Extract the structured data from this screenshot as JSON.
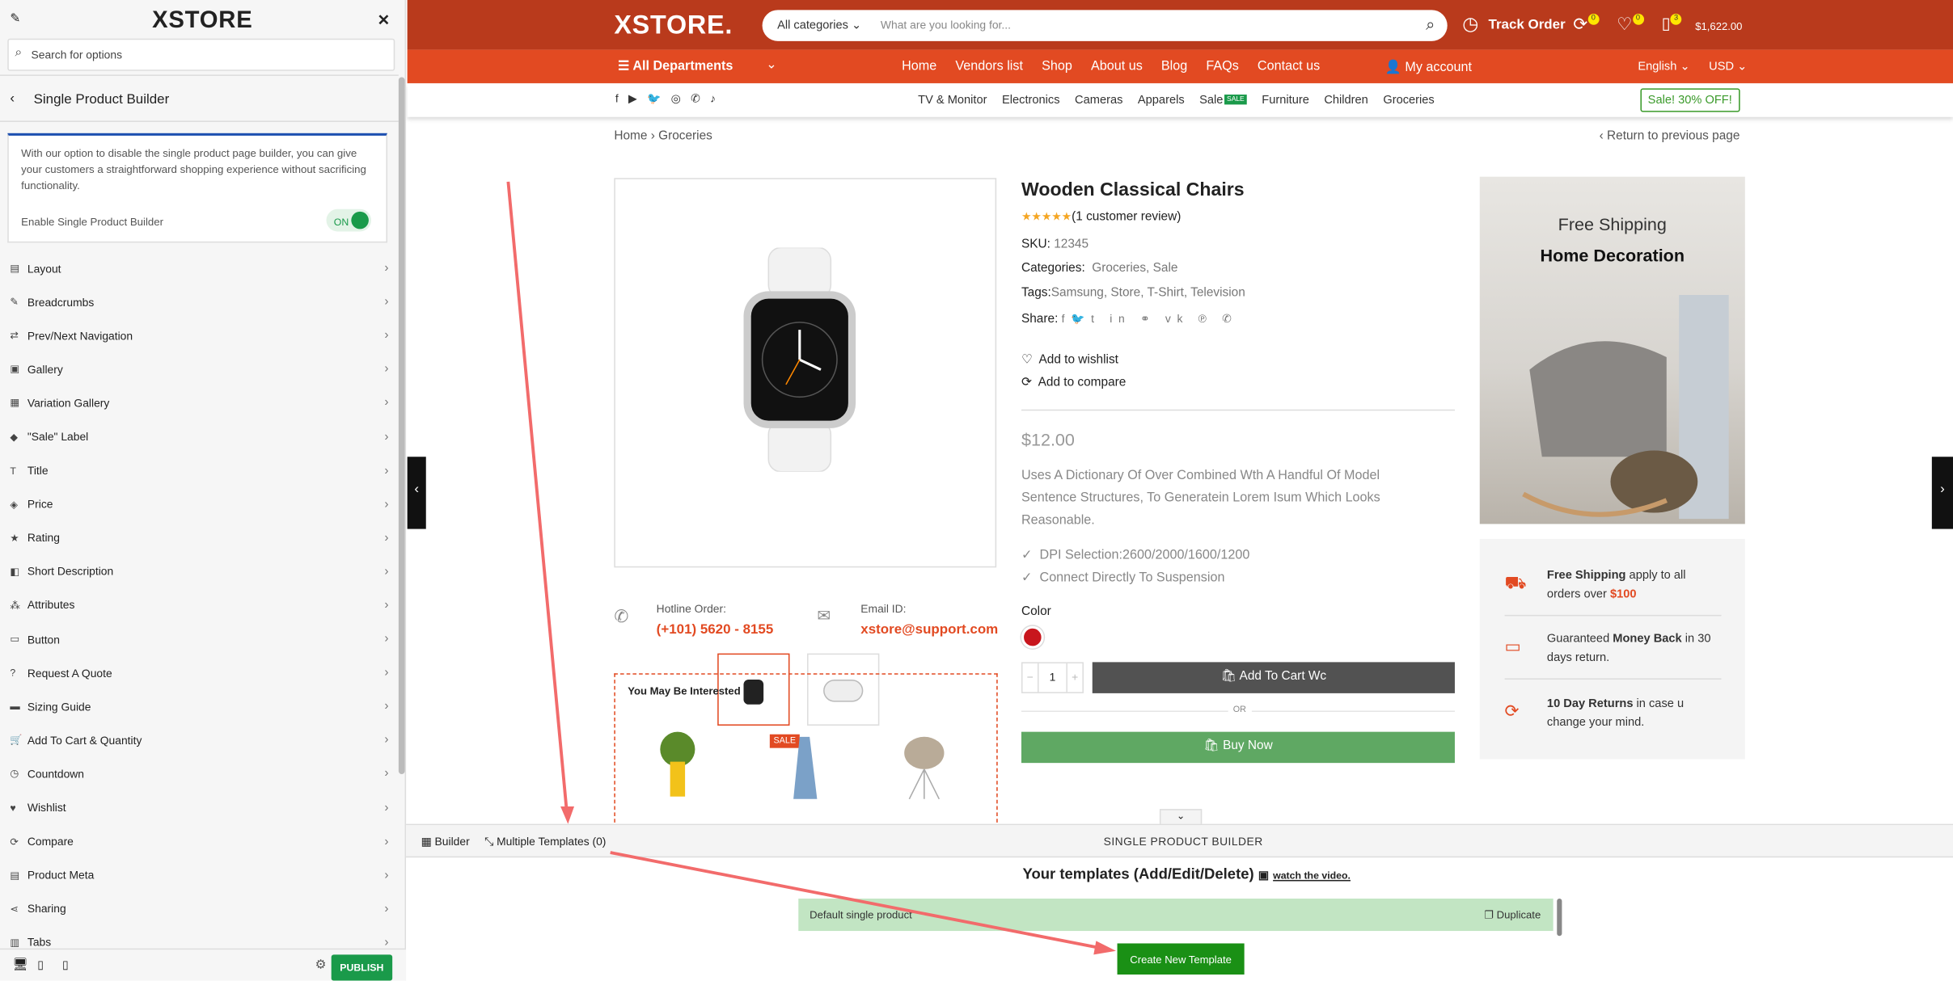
{
  "sidebar": {
    "logo": "XSTORE",
    "search_placeholder": "Search for options",
    "section_title": "Single Product Builder",
    "notice": "With our option to disable the single product page builder, you can give your customers a straightforward shopping experience without sacrificing functionality.",
    "toggle_label": "Enable Single Product Builder",
    "toggle_state": "ON",
    "items": [
      {
        "label": "Layout",
        "icon": "layout-icon"
      },
      {
        "label": "Breadcrumbs",
        "icon": "brush-icon"
      },
      {
        "label": "Prev/Next Navigation",
        "icon": "arrows-icon"
      },
      {
        "label": "Gallery",
        "icon": "image-icon"
      },
      {
        "label": "Variation Gallery",
        "icon": "gallery-icon"
      },
      {
        "label": "\"Sale\" Label",
        "icon": "tag-icon"
      },
      {
        "label": "Title",
        "icon": "title-icon"
      },
      {
        "label": "Price",
        "icon": "price-tag-icon"
      },
      {
        "label": "Rating",
        "icon": "star-icon"
      },
      {
        "label": "Short Description",
        "icon": "description-icon"
      },
      {
        "label": "Attributes",
        "icon": "attributes-icon"
      },
      {
        "label": "Button",
        "icon": "button-icon"
      },
      {
        "label": "Request A Quote",
        "icon": "question-icon"
      },
      {
        "label": "Sizing Guide",
        "icon": "ruler-icon"
      },
      {
        "label": "Add To Cart & Quantity",
        "icon": "cart-icon"
      },
      {
        "label": "Countdown",
        "icon": "clock-icon"
      },
      {
        "label": "Wishlist",
        "icon": "heart-icon"
      },
      {
        "label": "Compare",
        "icon": "compare-icon"
      },
      {
        "label": "Product Meta",
        "icon": "meta-icon"
      },
      {
        "label": "Sharing",
        "icon": "share-icon"
      },
      {
        "label": "Tabs",
        "icon": "tabs-icon"
      }
    ],
    "publish": "PUBLISH"
  },
  "header": {
    "logo": "XSTORE.",
    "category": "All categories",
    "search_placeholder": "What are you looking for...",
    "track_order": "Track Order",
    "compare_count": "0",
    "wishlist_count": "0",
    "cart_count": "3",
    "cart_total": "$1,622.00"
  },
  "nav": {
    "departments": "All Departments",
    "links": [
      "Home",
      "Vendors list",
      "Shop",
      "About us",
      "Blog",
      "FAQs",
      "Contact us"
    ],
    "account": "My account",
    "language": "English",
    "currency": "USD"
  },
  "subnav": {
    "links": [
      "TV & Monitor",
      "Electronics",
      "Cameras",
      "Apparels",
      "Sale",
      "Furniture",
      "Children",
      "Groceries"
    ],
    "sale_badge": "SALE",
    "promo": "Sale! 30% OFF!"
  },
  "breadcrumb": {
    "items": [
      "Home",
      "Groceries"
    ],
    "back": "Return to previous page"
  },
  "product": {
    "title": "Wooden Classical Chairs",
    "rating": 5,
    "reviews": "(1 customer review)",
    "sku_label": "SKU:",
    "sku": "12345",
    "categories_label": "Categories:",
    "categories": "Groceries, Sale",
    "tags_label": "Tags:",
    "tags": "Samsung, Store, T-Shirt, Television",
    "share_label": "Share:",
    "wishlist": "Add to wishlist",
    "compare": "Add to compare",
    "price": "$12.00",
    "description": "Uses A Dictionary Of Over Combined Wth A Handful Of Model Sentence Structures, To Generatein Lorem Isum Which Looks Reasonable.",
    "features": [
      "DPI Selection:2600/2000/1600/1200",
      "Connect Directly To Suspension"
    ],
    "color_label": "Color",
    "color": "#c8161d",
    "quantity": "1",
    "add_to_cart": "Add To Cart Wc",
    "or": "OR",
    "buy_now": "Buy Now"
  },
  "contact": {
    "hotline_label": "Hotline Order:",
    "hotline": "(+101) 5620 - 8155",
    "email_label": "Email ID:",
    "email": "xstore@support.com"
  },
  "related": {
    "title": "You May Be Interested In...",
    "sale_badge": "SALE"
  },
  "banner": {
    "line1": "Free Shipping",
    "line2": "Home Decoration"
  },
  "benefits": [
    {
      "bold": "Free Shipping",
      "text": " apply to all orders over ",
      "highlight": "$100"
    },
    {
      "pre": "Guaranteed ",
      "bold": "Money Back",
      "text": " in 30 days return."
    },
    {
      "bold": "10 Day Returns",
      "text": " in case u change your mind."
    }
  ],
  "builder": {
    "tab_builder": "Builder",
    "tab_templates": "Multiple Templates (0)",
    "title": "SINGLE PRODUCT BUILDER",
    "templates_heading": "Your templates (Add/Edit/Delete)",
    "watch": "watch the video.",
    "template_name": "Default single product",
    "duplicate": "Duplicate",
    "create": "Create New Template"
  },
  "colors": {
    "header": "#b93a1c",
    "nav": "#e24a22",
    "green": "#1a9a4a",
    "buy_now": "#5fa863",
    "create": "#1a9015",
    "annotation": "#f26b6b"
  }
}
